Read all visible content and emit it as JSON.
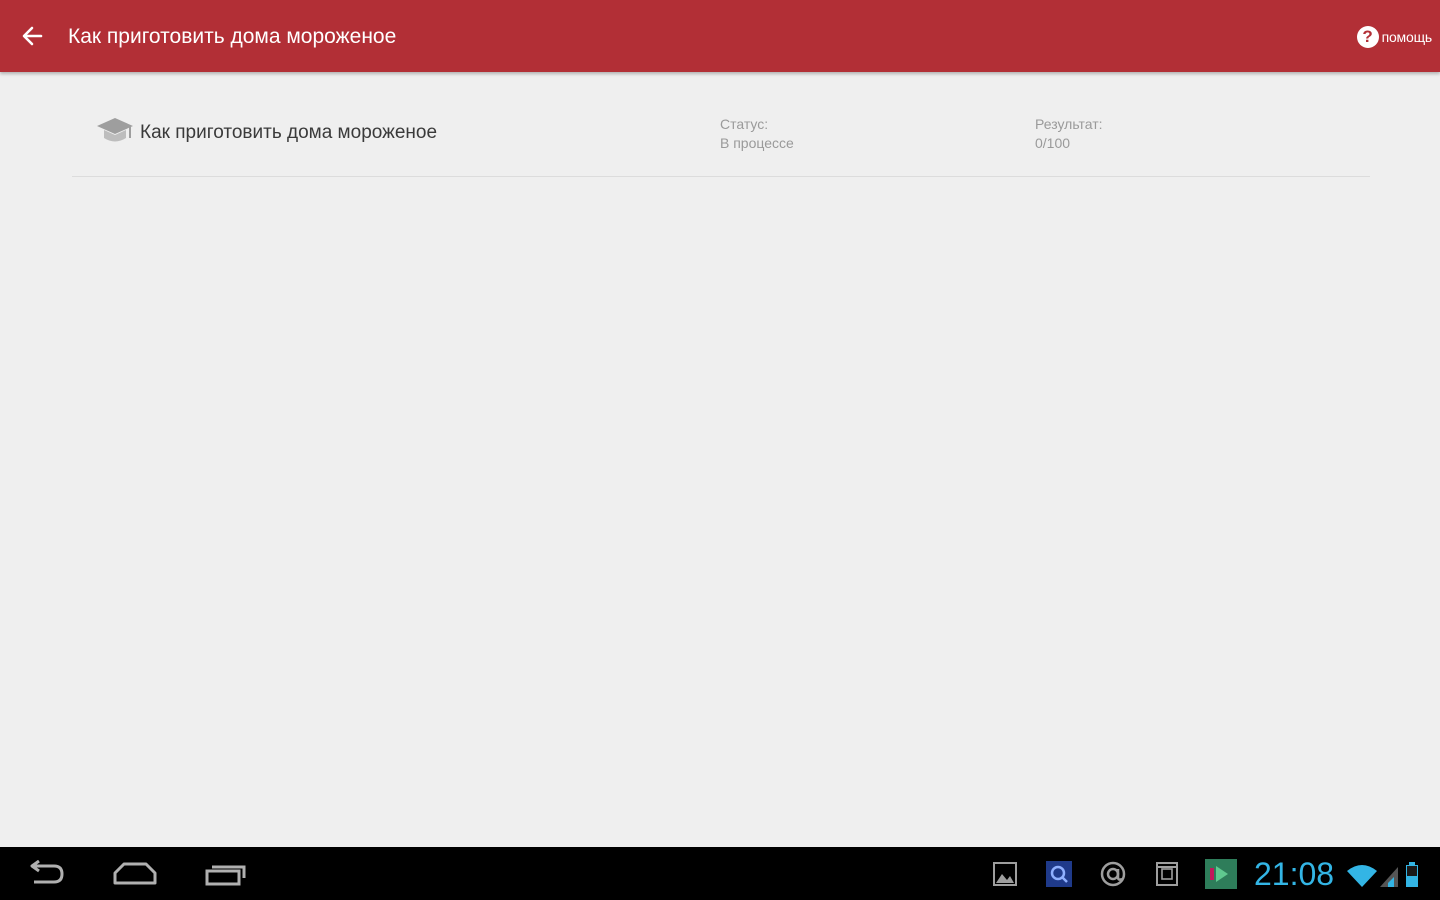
{
  "appbar": {
    "title": "Как приготовить дома мороженое",
    "help_label": "помощь",
    "help_glyph": "?",
    "back_icon": "arrow-back-icon",
    "color": "#b22f36"
  },
  "course": {
    "title": "Как приготовить дома мороженое",
    "icon": "graduation-cap-icon",
    "status_label": "Статус:",
    "status_value": "В процессе",
    "result_label": "Результат:",
    "result_value": "0/100"
  },
  "system_bar": {
    "clock": "21:08",
    "clock_color": "#33b5e5",
    "nav_icons": [
      "back-icon",
      "home-icon",
      "recent-apps-icon"
    ],
    "tray_icons": [
      "gallery-icon",
      "search-app-icon",
      "email-icon",
      "calendar-icon",
      "play-store-icon"
    ],
    "status_icons": [
      "wifi-icon",
      "signal-icon",
      "battery-icon"
    ]
  }
}
